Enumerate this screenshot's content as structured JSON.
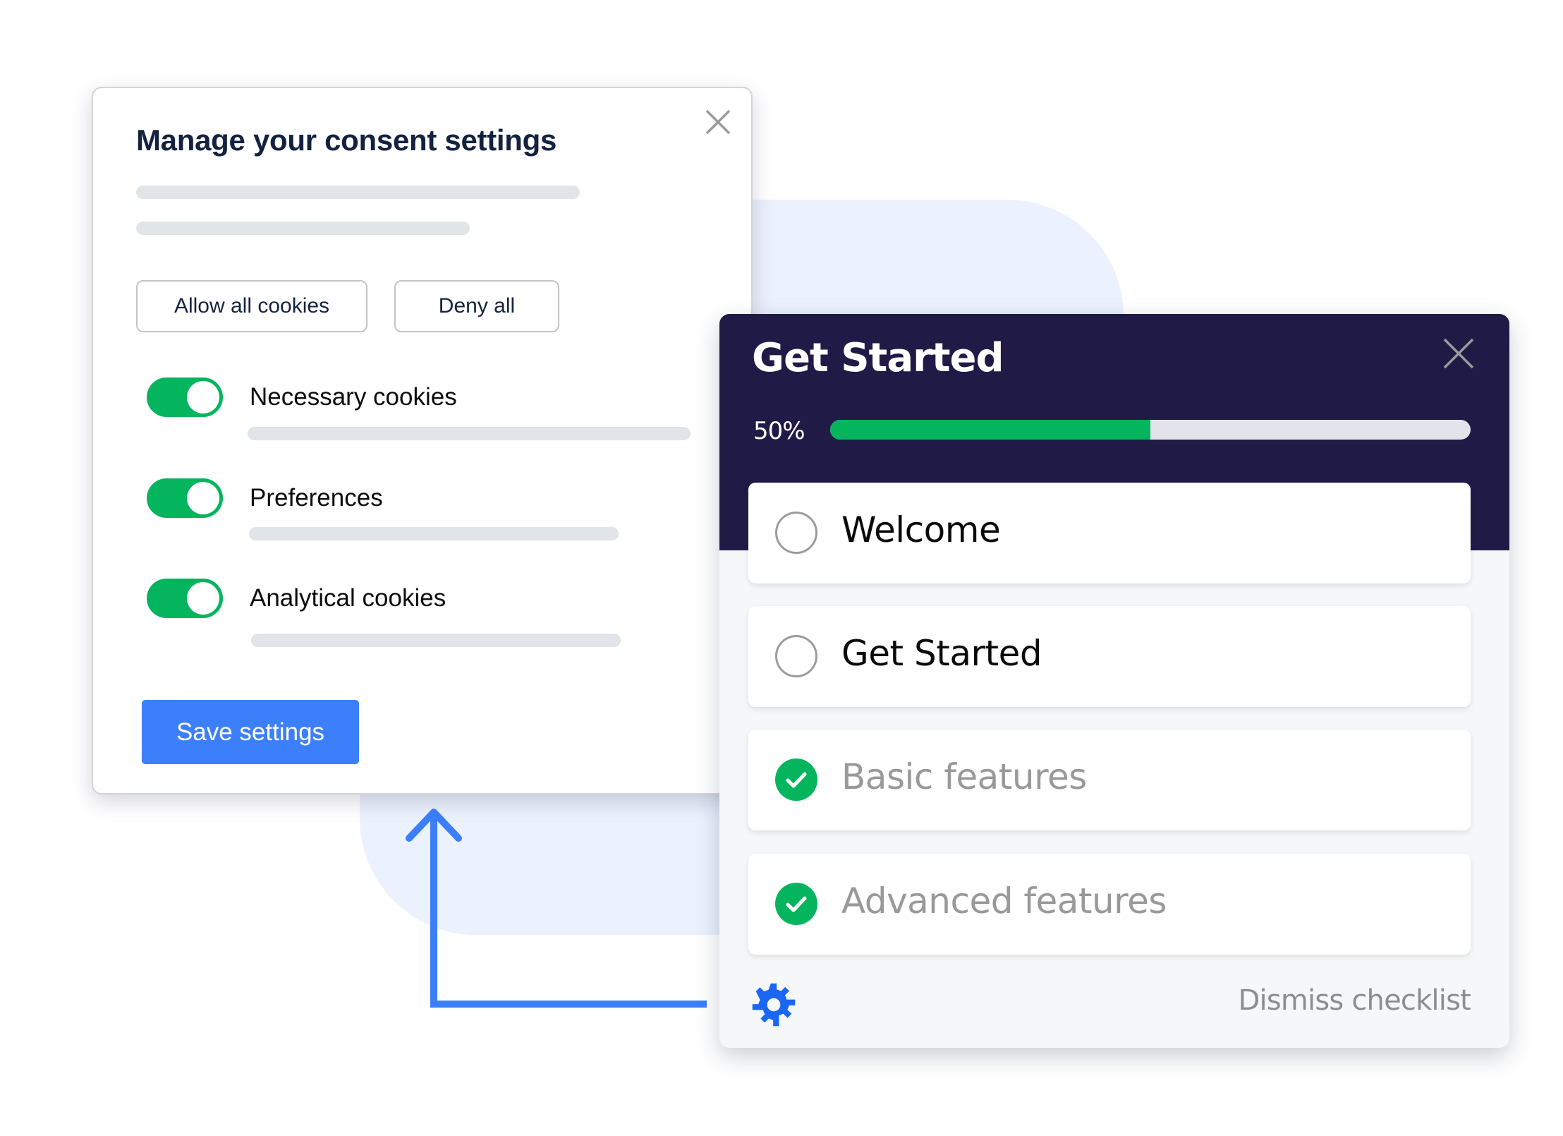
{
  "consent": {
    "title": "Manage your consent settings",
    "allow_all_label": "Allow all cookies",
    "deny_all_label": "Deny all",
    "toggles": [
      {
        "label": "Necessary cookies",
        "enabled": true
      },
      {
        "label": "Preferences",
        "enabled": true
      },
      {
        "label": "Analytical cookies",
        "enabled": true
      }
    ],
    "save_label": "Save settings",
    "close_icon": "close-icon"
  },
  "checklist": {
    "title": "Get Started",
    "progress_label": "50%",
    "progress_fraction": 0.5,
    "items": [
      {
        "label": "Welcome",
        "done": false
      },
      {
        "label": "Get Started",
        "done": false
      },
      {
        "label": "Basic features",
        "done": true
      },
      {
        "label": "Advanced features",
        "done": true
      }
    ],
    "dismiss_label": "Dismiss checklist",
    "settings_icon": "gear-icon",
    "close_icon": "close-icon"
  },
  "colors": {
    "accent_blue": "#3c7ffb",
    "success_green": "#05b55e",
    "header_navy": "#201a47",
    "gear_blue": "#1a66f5"
  }
}
